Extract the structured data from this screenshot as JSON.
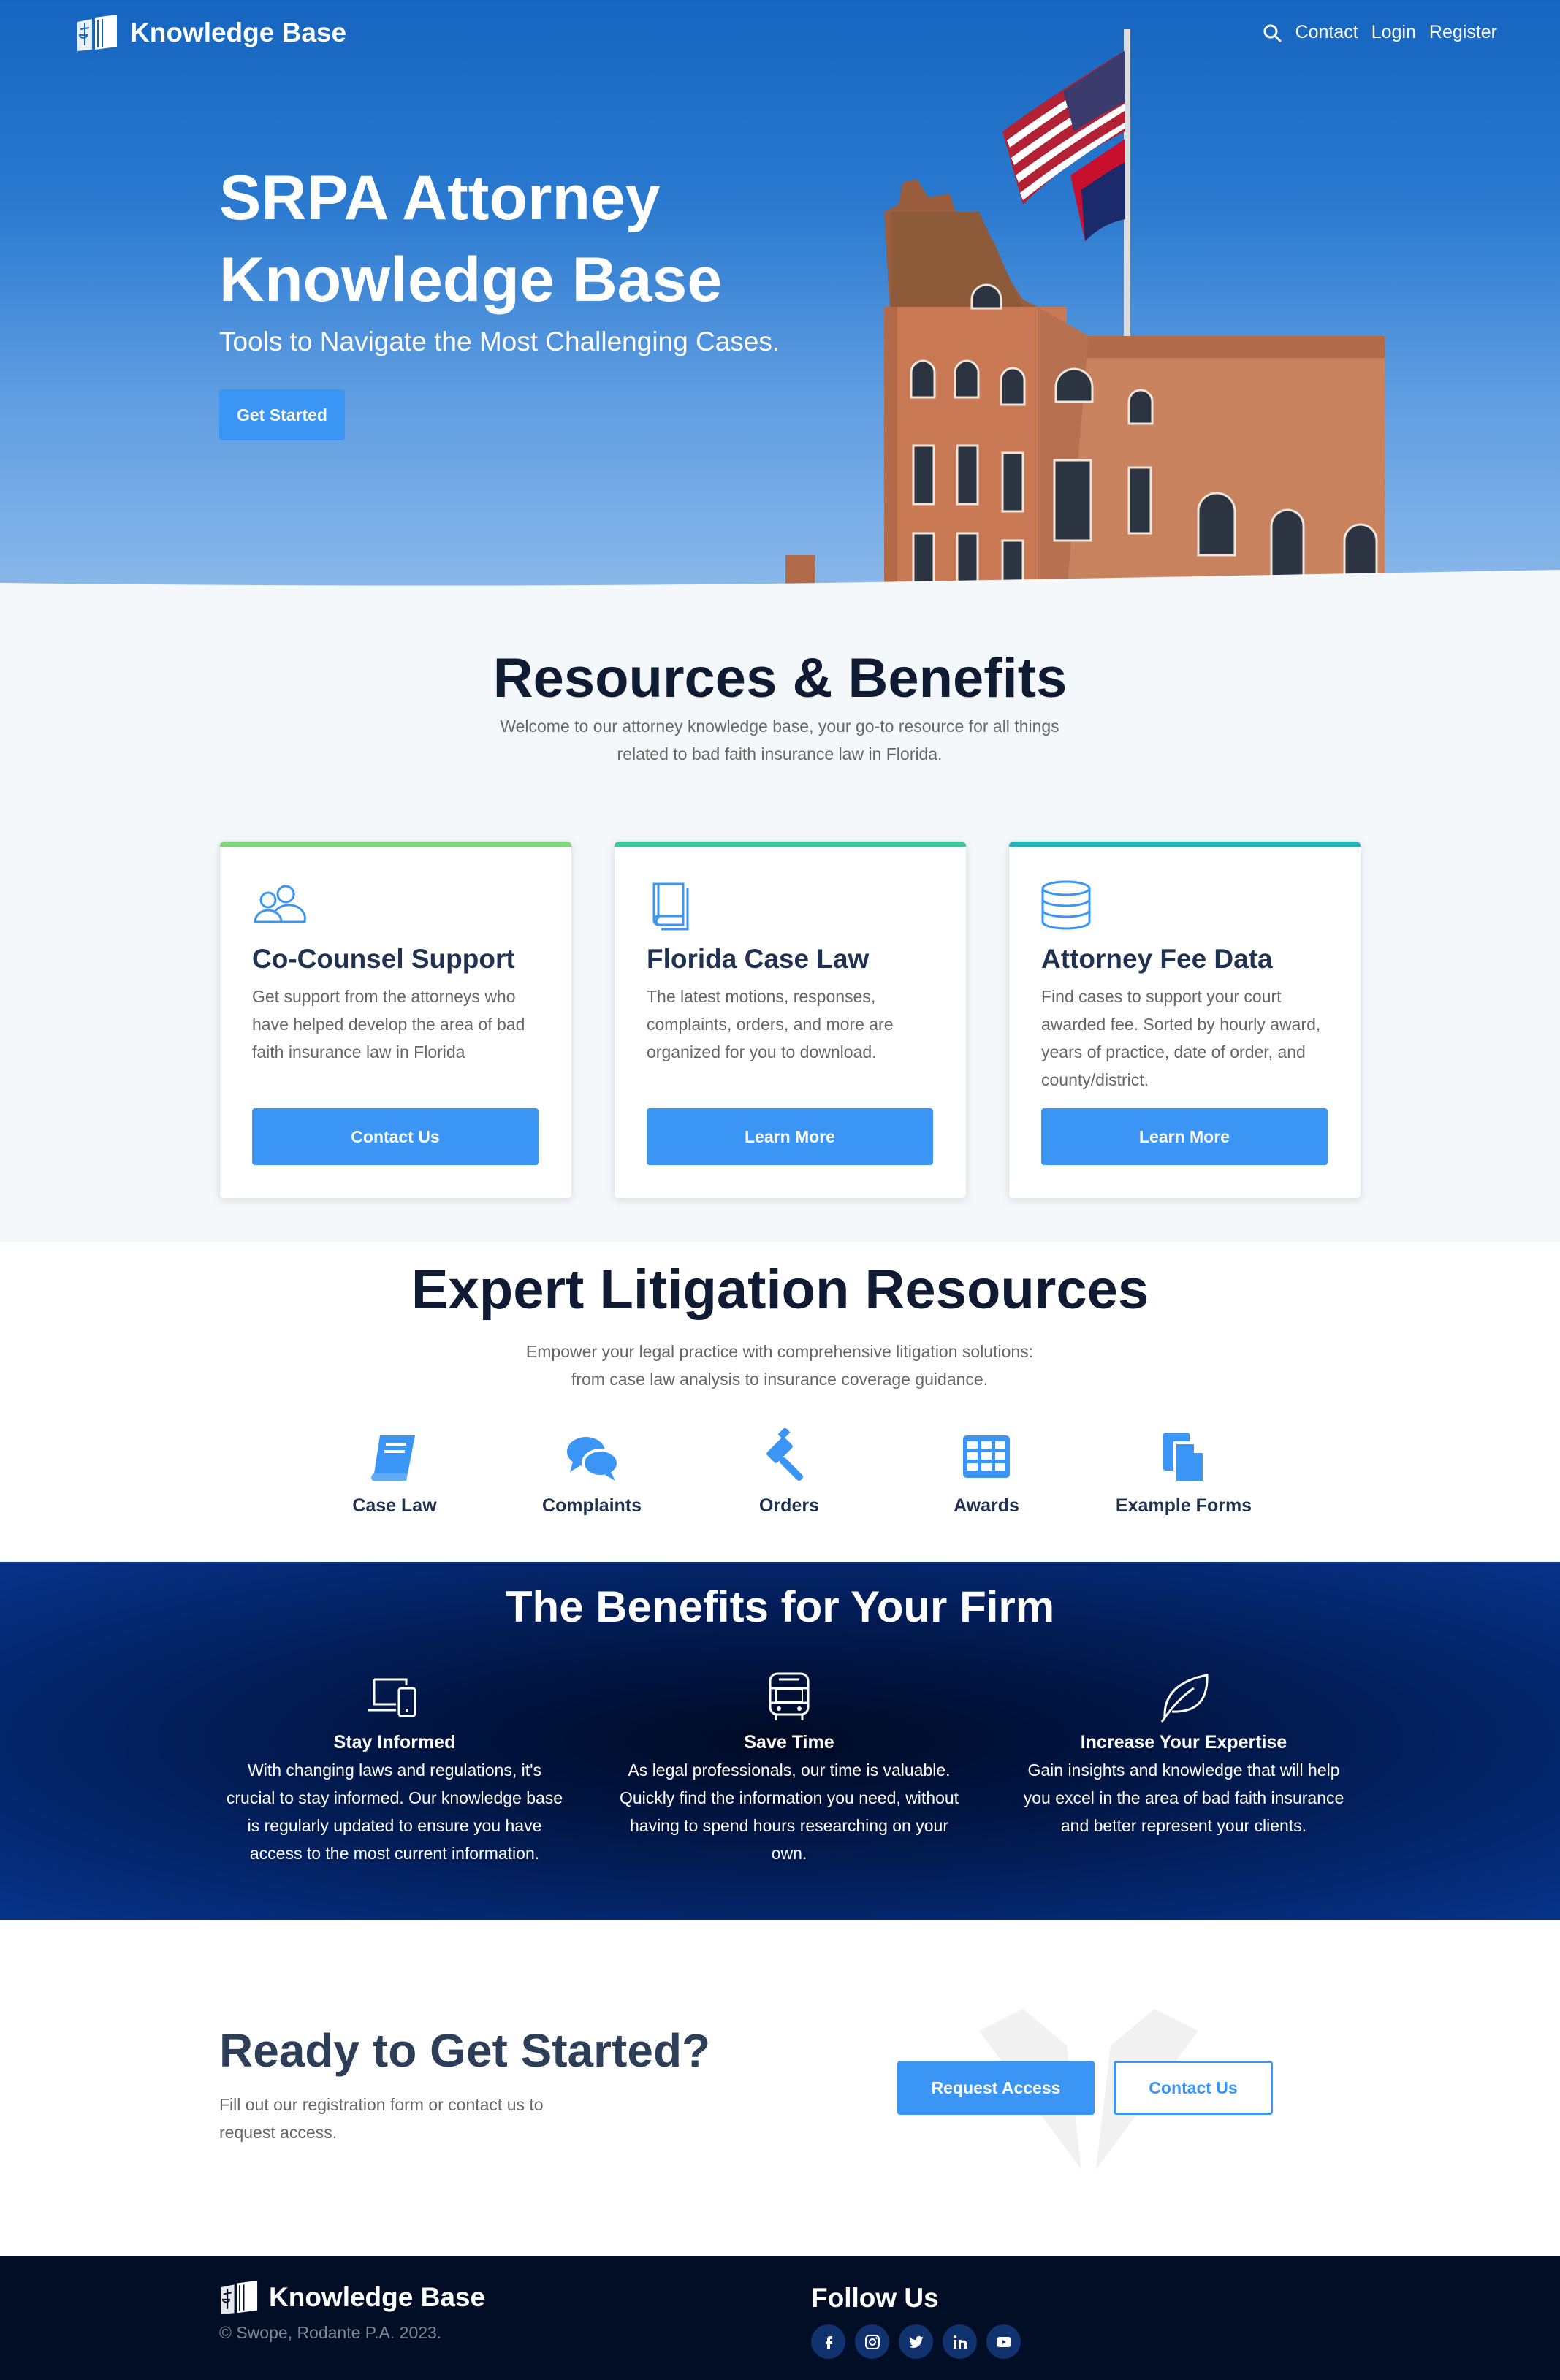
{
  "nav": {
    "logo_text": "Knowledge Base",
    "links": [
      "Contact",
      "Login",
      "Register"
    ]
  },
  "hero": {
    "title": "SRPA Attorney Knowledge Base",
    "subtitle": "Tools to Navigate the Most Challenging Cases.",
    "button": "Get Started"
  },
  "resources": {
    "title": "Resources & Benefits",
    "description": "Welcome to our attorney knowledge base, your go-to resource for all things related to bad faith insurance law in Florida.",
    "cards": [
      {
        "icon": "users-icon",
        "title": "Co-Counsel Support",
        "text": "Get support from the attorneys who have helped develop the area of bad faith insurance law in Florida",
        "button": "Contact Us",
        "accent": "#7dd87a"
      },
      {
        "icon": "book-icon",
        "title": "Florida Case Law",
        "text": "The latest motions, responses, complaints, orders, and more are organized for you to download.",
        "button": "Learn More",
        "accent": "#3fc49a"
      },
      {
        "icon": "database-icon",
        "title": "Attorney Fee Data",
        "text": "Find cases to support your court awarded fee. Sorted by hourly award, years of practice, date of order, and county/district.",
        "button": "Learn More",
        "accent": "#25b1b8"
      }
    ]
  },
  "litigation": {
    "title": "Expert Litigation Resources",
    "description": "Empower your legal practice with comprehensive litigation solutions: from case law analysis to insurance coverage guidance.",
    "items": [
      {
        "label": "Case Law",
        "icon": "book-icon"
      },
      {
        "label": "Complaints",
        "icon": "chat-bubbles-icon"
      },
      {
        "label": "Orders",
        "icon": "gavel-icon"
      },
      {
        "label": "Awards",
        "icon": "table-grid-icon"
      },
      {
        "label": "Example Forms",
        "icon": "documents-icon"
      }
    ]
  },
  "benefits": {
    "title": "The Benefits for Your Firm",
    "items": [
      {
        "icon": "devices-icon",
        "title": "Stay Informed",
        "text": "With changing laws and regulations, it's crucial to stay informed. Our knowledge base is regularly updated to ensure you have access to the most current information."
      },
      {
        "icon": "bus-icon",
        "title": "Save Time",
        "text": "As legal professionals, our time is valuable. Quickly find the information you need, without having to spend hours researching on your own."
      },
      {
        "icon": "leaf-icon",
        "title": "Increase Your Expertise",
        "text": "Gain insights and knowledge that will help you excel in the area of bad faith insurance and better represent your clients."
      }
    ]
  },
  "cta": {
    "title": "Ready to Get Started?",
    "text": "Fill out our registration form or contact us to request access.",
    "primary_button": "Request Access",
    "secondary_button": "Contact Us"
  },
  "footer": {
    "logo_text": "Knowledge Base",
    "copyright": "© Swope, Rodante P.A. 2023.",
    "follow_title": "Follow Us",
    "social": [
      "facebook-icon",
      "instagram-icon",
      "twitter-icon",
      "linkedin-icon",
      "youtube-icon"
    ]
  },
  "colors": {
    "primary": "#3a95f4",
    "heading": "#0f1b33",
    "footer_bg": "#020d26"
  }
}
